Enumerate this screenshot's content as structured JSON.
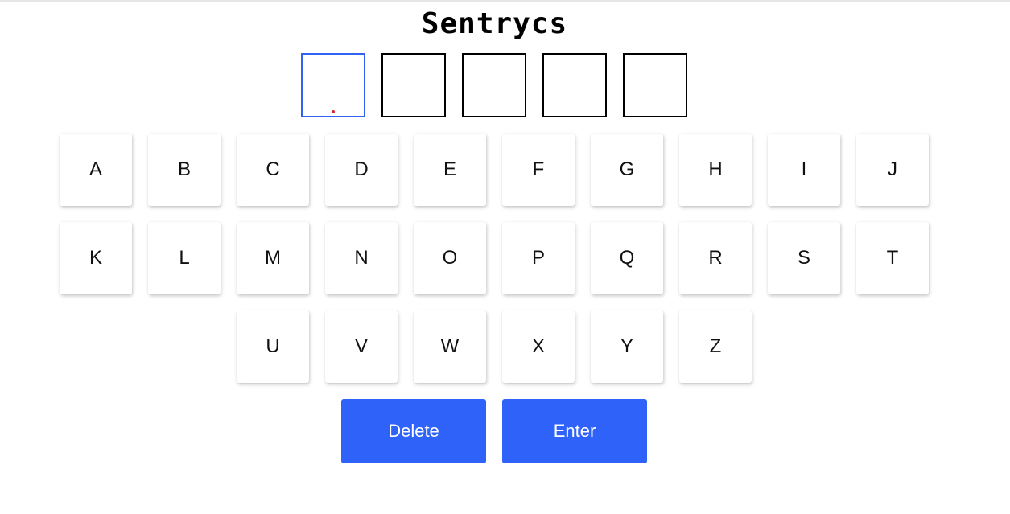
{
  "app": {
    "title": "Sentrycs"
  },
  "slots": [
    {
      "value": ""
    },
    {
      "value": ""
    },
    {
      "value": ""
    },
    {
      "value": ""
    },
    {
      "value": ""
    }
  ],
  "keyboard": {
    "row1": [
      "A",
      "B",
      "C",
      "D",
      "E",
      "F",
      "G",
      "H",
      "I",
      "J"
    ],
    "row2": [
      "K",
      "L",
      "M",
      "N",
      "O",
      "P",
      "Q",
      "R",
      "S",
      "T"
    ],
    "row3": [
      "U",
      "V",
      "W",
      "X",
      "Y",
      "Z"
    ]
  },
  "actions": {
    "delete_label": "Delete",
    "enter_label": "Enter"
  },
  "colors": {
    "accent": "#2f62f9",
    "active_slot_border": "#2f62f0",
    "caret": "#d9262e"
  }
}
